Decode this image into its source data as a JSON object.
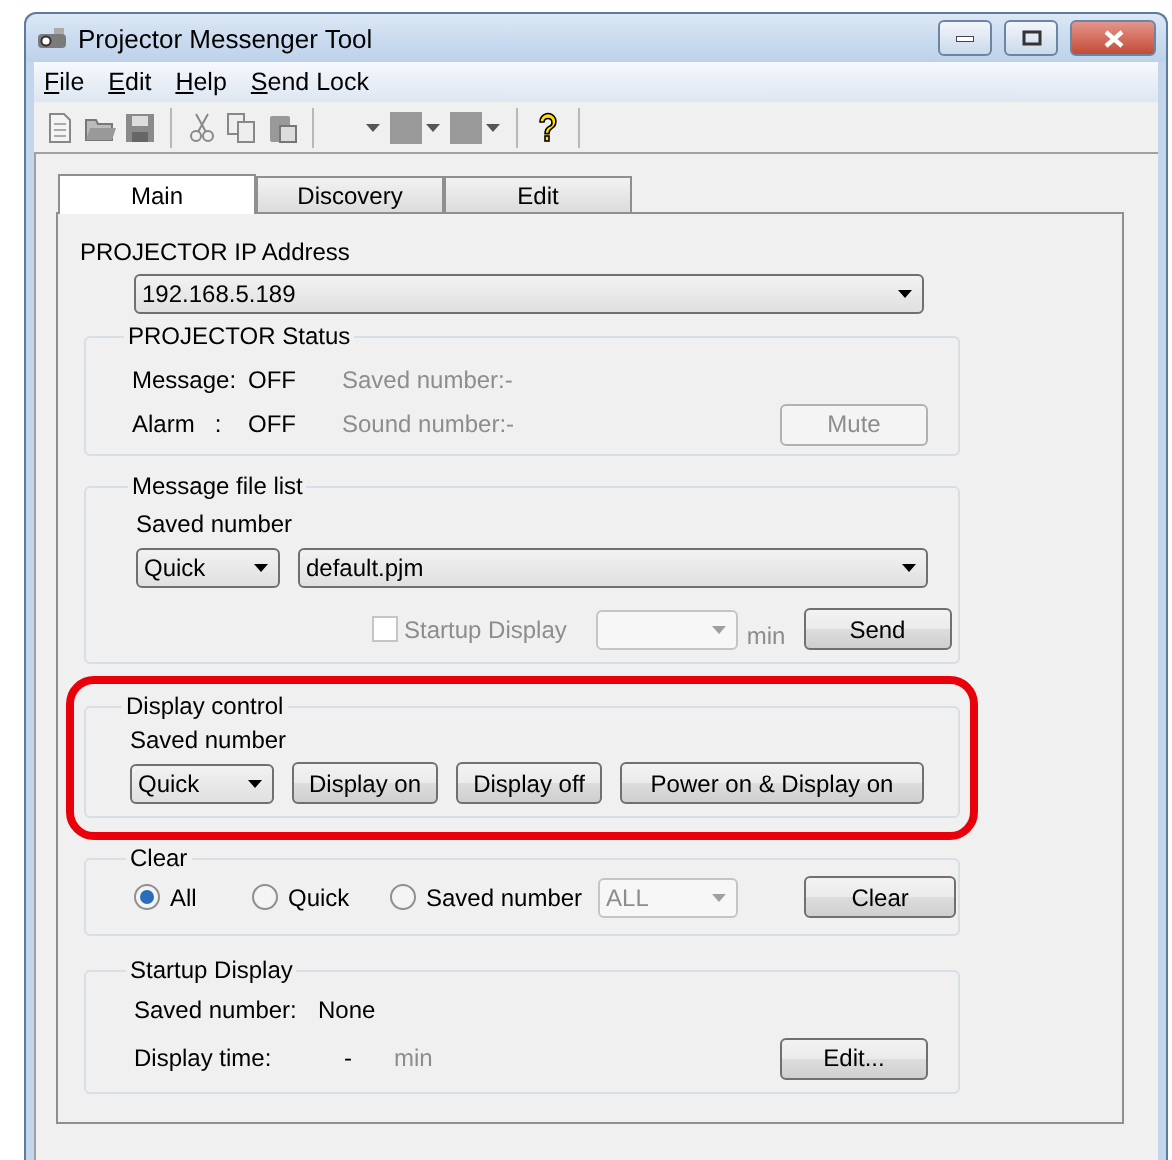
{
  "window": {
    "title": "Projector Messenger Tool"
  },
  "menu": [
    "File",
    "Edit",
    "Help",
    "Send Lock"
  ],
  "tabs": [
    {
      "label": "Main",
      "selected": true
    },
    {
      "label": "Discovery",
      "selected": false
    },
    {
      "label": "Edit",
      "selected": false
    }
  ],
  "ip_address": {
    "label": "PROJECTOR IP Address",
    "value": "192.168.5.189"
  },
  "projector_status": {
    "title": "PROJECTOR Status",
    "rows": [
      {
        "label": "Message:",
        "value": "OFF",
        "detail": "Saved number:-"
      },
      {
        "label": "Alarm   :",
        "value": "OFF",
        "detail": "Sound number:-"
      }
    ],
    "mute_button": {
      "label": "Mute",
      "disabled": true
    }
  },
  "message_file_list": {
    "title": "Message file list",
    "saved_number_label": "Saved number",
    "type_select": "Quick",
    "file_select": "default.pjm",
    "startup_checkbox": {
      "label": "Startup Display",
      "checked": false,
      "disabled": true
    },
    "minutes_unit": "min",
    "send_button": "Send"
  },
  "display_control": {
    "title": "Display control",
    "highlighted": true,
    "saved_number_label": "Saved number",
    "type_select": "Quick",
    "buttons": [
      "Display on",
      "Display off",
      "Power on & Display on"
    ]
  },
  "clear": {
    "title": "Clear",
    "options": [
      {
        "label": "All",
        "selected": true
      },
      {
        "label": "Quick",
        "selected": false
      },
      {
        "label": "Saved number",
        "selected": false
      }
    ],
    "number_select": {
      "value": "ALL",
      "disabled": true
    },
    "clear_button": "Clear"
  },
  "startup_display": {
    "title": "Startup Display",
    "rows": [
      {
        "label": "Saved number:",
        "value": "None"
      },
      {
        "label": "Display time:",
        "value": "-",
        "unit": "min"
      }
    ],
    "edit_button": "Edit..."
  }
}
